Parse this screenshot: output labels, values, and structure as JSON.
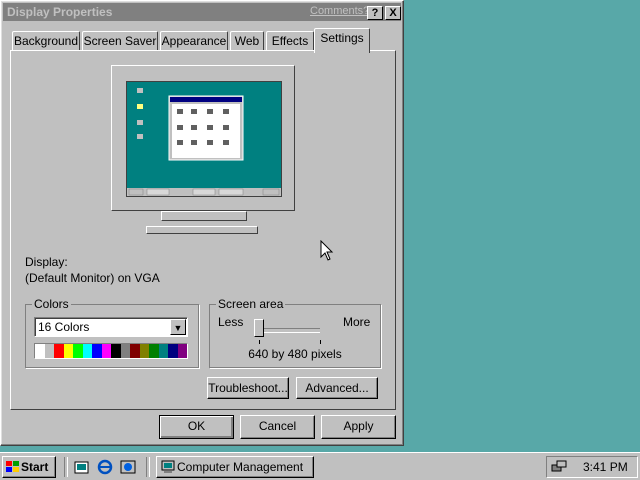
{
  "window": {
    "title": "Display Properties",
    "comments_link": "Comments?",
    "help_button": "?",
    "close_button": "X"
  },
  "tabs": [
    {
      "label": "Background",
      "active": false
    },
    {
      "label": "Screen Saver",
      "active": false
    },
    {
      "label": "Appearance",
      "active": false
    },
    {
      "label": "Web",
      "active": false
    },
    {
      "label": "Effects",
      "active": false
    },
    {
      "label": "Settings",
      "active": true
    }
  ],
  "settings": {
    "display_label": "Display:",
    "display_value": "(Default Monitor) on VGA",
    "colors": {
      "group_label": "Colors",
      "selected": "16 Colors",
      "palette": [
        "#ffffff",
        "#c0c0c0",
        "#ff0000",
        "#ffff00",
        "#00ff00",
        "#00ffff",
        "#0000ff",
        "#ff00ff",
        "#000000",
        "#808080",
        "#800000",
        "#808000",
        "#008000",
        "#008080",
        "#000080",
        "#800080"
      ]
    },
    "screen_area": {
      "group_label": "Screen area",
      "less_label": "Less",
      "more_label": "More",
      "resolution": "640 by 480 pixels",
      "slider_level": 0
    },
    "troubleshoot_button": "Troubleshoot...",
    "advanced_button": "Advanced..."
  },
  "dialog_buttons": {
    "ok": "OK",
    "cancel": "Cancel",
    "apply": "Apply"
  },
  "taskbar": {
    "start_label": "Start",
    "task_label": "Computer Management",
    "clock": "3:41 PM",
    "quick_launch_icons": [
      "show-desktop-icon",
      "internet-explorer-icon",
      "channels-icon"
    ]
  }
}
